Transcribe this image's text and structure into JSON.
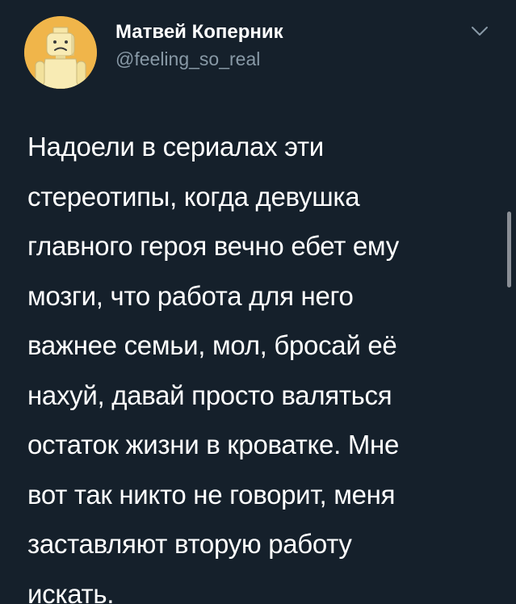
{
  "tweet": {
    "author": {
      "display_name": "Матвей Коперник",
      "handle": "@feeling_so_real",
      "avatar_icon": "lego-figure-avatar",
      "avatar_color": "#f0b54a"
    },
    "menu_icon": "chevron-down-icon",
    "text_lines": [
      "Надоели в сериалах эти",
      "стереотипы, когда девушка",
      "главного героя вечно ебет ему",
      "мозги, что работа для него",
      "важнее семьи, мол, бросай её",
      "нахуй, давай просто валяться",
      "остаток жизни в кроватке. Мне",
      "вот так никто не говорит, меня",
      "заставляют вторую работу",
      "искать."
    ]
  },
  "colors": {
    "background": "#15202b",
    "text": "#ffffff",
    "secondary_text": "#8899a6"
  }
}
